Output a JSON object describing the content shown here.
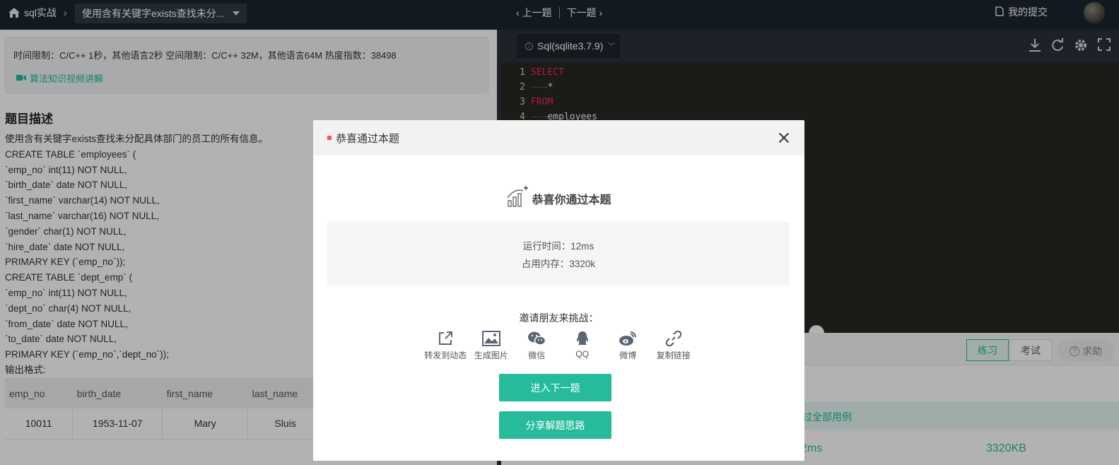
{
  "topbar": {
    "breadcrumb": "sql实战",
    "problem_title": "使用含有关键字exists查找未分...",
    "prev_label": "上一题",
    "next_label": "下一题",
    "my_submissions": "我的提交"
  },
  "problem": {
    "limits_text": "时间限制：C/C++ 1秒，其他语言2秒    空间限制：C/C++ 32M，其他语言64M    热度指数：38498",
    "video_link": "算法知识视频讲解",
    "section_title": "题目描述",
    "lines": [
      "使用含有关键字exists查找未分配具体部门的员工的所有信息。",
      "CREATE TABLE `employees` (",
      "`emp_no` int(11) NOT NULL,",
      "`birth_date` date NOT NULL,",
      "`first_name` varchar(14) NOT NULL,",
      "`last_name` varchar(16) NOT NULL,",
      "`gender` char(1) NOT NULL,",
      "`hire_date` date NOT NULL,",
      "PRIMARY KEY (`emp_no`));",
      "CREATE TABLE `dept_emp` (",
      "`emp_no` int(11) NOT NULL,",
      "`dept_no` char(4) NOT NULL,",
      "`from_date` date NOT NULL,",
      "`to_date` date NOT NULL,",
      "PRIMARY KEY (`emp_no`,`dept_no`));",
      "输出格式:"
    ],
    "table": {
      "headers": [
        "emp_no",
        "birth_date",
        "first_name",
        "last_name"
      ],
      "rows": [
        [
          "10011",
          "1953-11-07",
          "Mary",
          "Sluis"
        ]
      ]
    }
  },
  "editor": {
    "language": "Sql(sqlite3.7.9)",
    "code_lines": [
      {
        "num": "1",
        "lead": "",
        "text": "SELECT",
        "kw": true
      },
      {
        "num": "2",
        "lead": "——→",
        "text": "*",
        "kw": false
      },
      {
        "num": "3",
        "lead": "",
        "text": "FROM",
        "kw": true
      },
      {
        "num": "4",
        "lead": "——→",
        "text": "employees",
        "kw": false
      }
    ]
  },
  "bottom": {
    "tab_practice": "练习",
    "tab_exam": "考试",
    "help_label": "求助",
    "pass_text": "过全部用例",
    "runtime_value": "2ms",
    "memory_value": "3320KB"
  },
  "modal": {
    "title": "恭喜通过本题",
    "congrats": "恭喜你通过本题",
    "runtime": "运行时间：12ms",
    "memory": "占用内存：3320k",
    "invite": "邀请朋友来挑战：",
    "shares": [
      {
        "icon": "share-out-icon",
        "label": "转发到动态"
      },
      {
        "icon": "image-icon",
        "label": "生成图片"
      },
      {
        "icon": "wechat-icon",
        "label": "微信"
      },
      {
        "icon": "qq-icon",
        "label": "QQ"
      },
      {
        "icon": "weibo-icon",
        "label": "微博"
      },
      {
        "icon": "link-icon",
        "label": "复制链接"
      }
    ],
    "next_button": "进入下一题",
    "share_button": "分享解题思路"
  },
  "colors": {
    "accent": "#25bb9b",
    "topbar": "#1c2430",
    "editor_bg": "#272822",
    "keyword": "#f92672"
  }
}
